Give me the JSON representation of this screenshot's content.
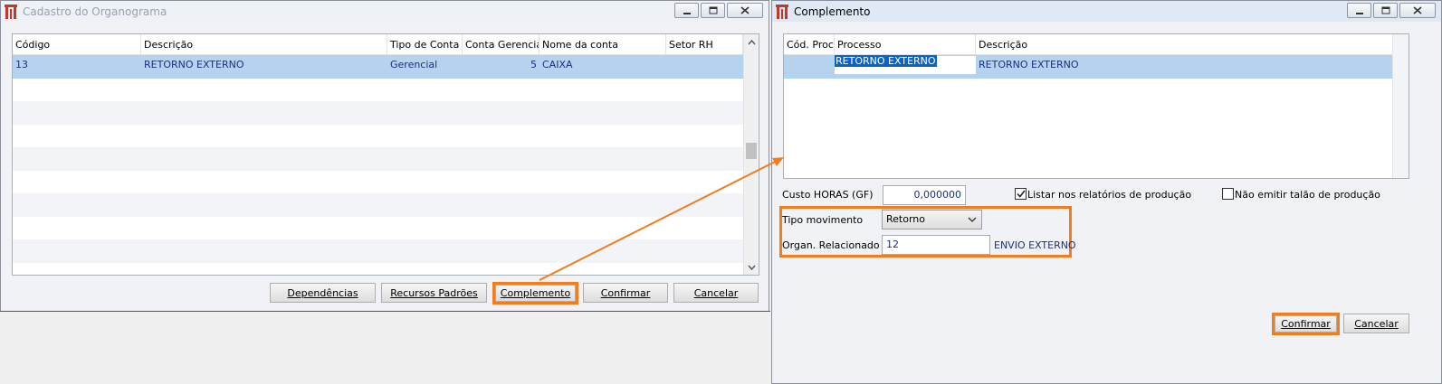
{
  "left_window": {
    "title": "Cadastro do Organograma",
    "grid": {
      "columns": [
        "Código",
        "Descrição",
        "Tipo de Conta",
        "Conta Gerencial",
        "Nome da conta",
        "Setor RH"
      ],
      "rows": [
        {
          "codigo": "13",
          "descricao": "RETORNO EXTERNO",
          "tipo_conta": "Gerencial",
          "conta_gerencial": "5",
          "nome_conta": "CAIXA",
          "setor_rh": ""
        }
      ]
    },
    "buttons": {
      "dependencias": "Dependências",
      "recursos": "Recursos Padrões",
      "complemento": "Complemento",
      "confirmar": "Confirmar",
      "cancelar": "Cancelar"
    }
  },
  "right_window": {
    "title": "Complemento",
    "grid": {
      "columns": [
        "Cód. Proc.",
        "Processo",
        "Descrição"
      ],
      "rows": [
        {
          "cod_proc": "",
          "processo": "RETORNO EXTERNO",
          "descricao": "RETORNO EXTERNO"
        }
      ]
    },
    "custo_label": "Custo HORAS (GF)",
    "custo_value": "0,000000",
    "listar_label": "Listar nos relatórios de produção",
    "listar_checked": true,
    "nao_emitir_label": "Não emitir talão de produção",
    "nao_emitir_checked": false,
    "tipo_mov_label": "Tipo movimento",
    "tipo_mov_value": "Retorno",
    "organ_label": "Organ. Relacionado",
    "organ_value": "12",
    "organ_desc": "ENVIO EXTERNO",
    "buttons": {
      "confirmar": "Confirmar",
      "cancelar": "Cancelar"
    }
  },
  "colors": {
    "highlight": "#f07e20",
    "selection": "#b5d3ef",
    "value_text": "#1c2f7e",
    "brand_icon": "#c0392b"
  },
  "icons": [
    "app-logo-icon",
    "minimize-icon",
    "maximize-icon",
    "close-icon",
    "scroll-up-icon",
    "scroll-down-icon",
    "checkmark-icon",
    "chevron-down-icon"
  ]
}
